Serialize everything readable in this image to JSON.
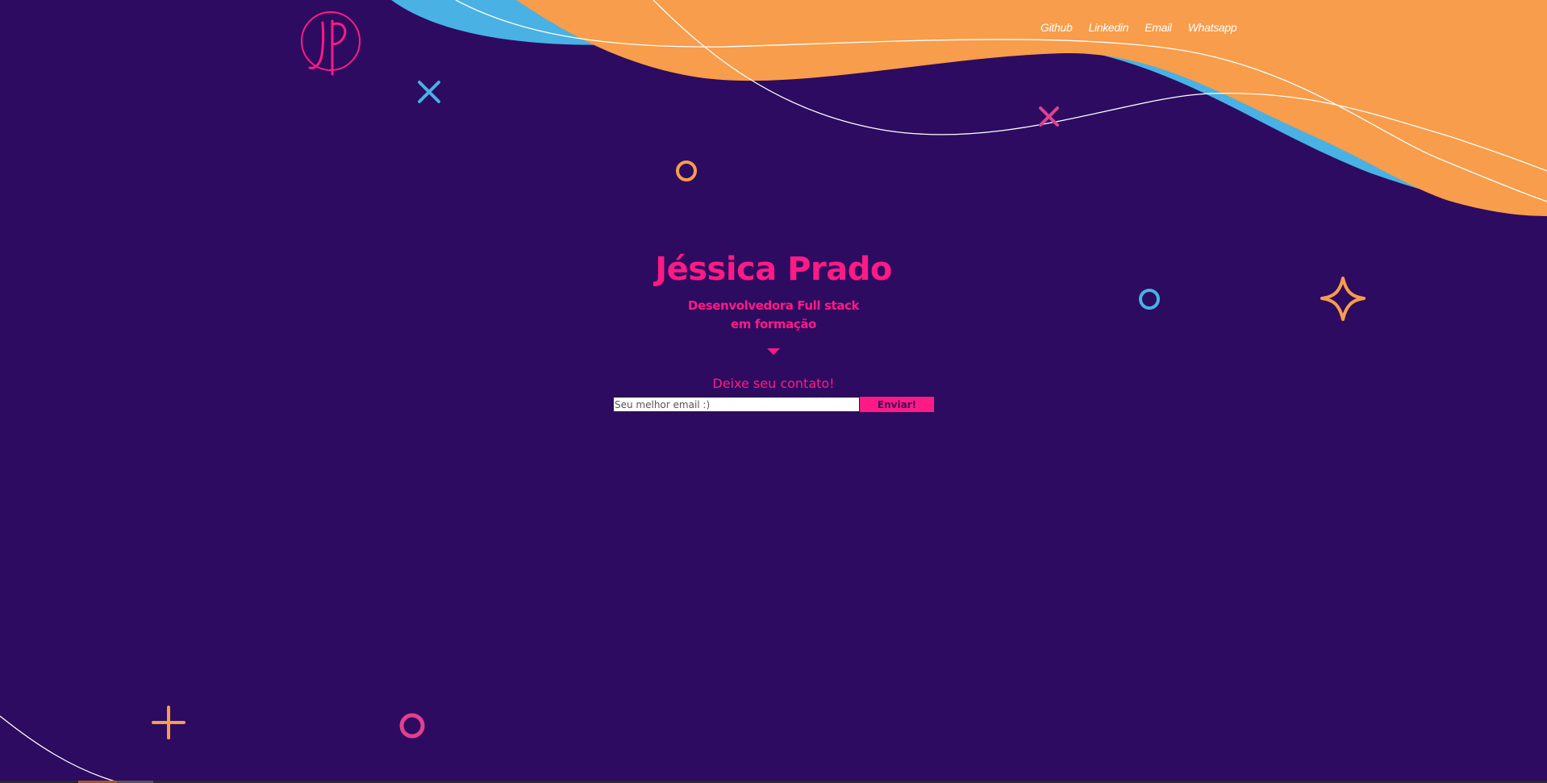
{
  "nav": {
    "items": [
      {
        "label": "Github"
      },
      {
        "label": "Linkedin"
      },
      {
        "label": "Email"
      },
      {
        "label": "Whatsapp"
      }
    ]
  },
  "hero": {
    "name": "Jéssica Prado",
    "subtitle_line1": "Desenvolvedora Full stack",
    "subtitle_line2": "em formação"
  },
  "contact": {
    "label": "Deixe seu contato!",
    "email_placeholder": "Seu melhor email :)",
    "submit_label": "Enviar!"
  },
  "colors": {
    "background": "#2d0b61",
    "accent_pink": "#ff1a85",
    "accent_orange": "#f79d4b",
    "accent_blue": "#49b1e3"
  },
  "icons": {
    "logo": "jp-monogram-logo",
    "decorations": [
      "cross-icon",
      "circle-icon",
      "sparkle-icon",
      "plus-icon"
    ]
  }
}
